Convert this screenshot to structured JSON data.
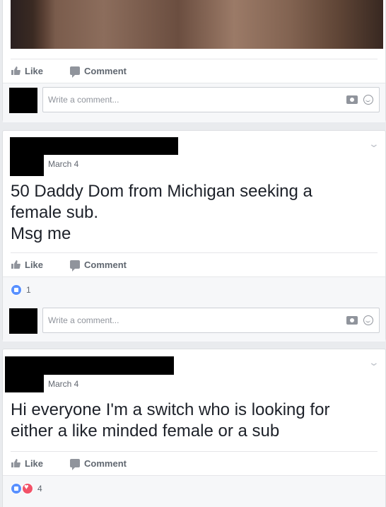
{
  "actions": {
    "like": "Like",
    "comment": "Comment"
  },
  "comment_box": {
    "placeholder": "Write a comment..."
  },
  "posts": [
    {
      "date": "",
      "text": "",
      "reaction_count": ""
    },
    {
      "date": "March 4",
      "text_lines": [
        "50 Daddy Dom from Michigan seeking a",
        "female sub.",
        "Msg me"
      ],
      "reaction_count": "1"
    },
    {
      "date": "March 4",
      "text_lines": [
        "Hi everyone I'm a switch who is looking for",
        "either a like minded female or a sub"
      ],
      "reaction_count": "4"
    }
  ],
  "icons": [
    "like-icon",
    "comment-icon",
    "camera-icon",
    "emoji-icon",
    "chevron-down-icon",
    "like-reaction-icon",
    "love-reaction-icon"
  ],
  "colors": {
    "background": "#e9ebee",
    "text": "#1d2129",
    "secondary": "#606770",
    "like_blue": "#5890ff",
    "love_red": "#f25268"
  }
}
